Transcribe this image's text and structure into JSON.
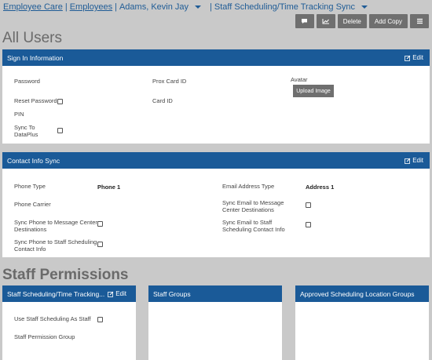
{
  "breadcrumb": {
    "items": [
      "Employee Care",
      "Employees",
      "Adams, Kevin Jay",
      "Staff Scheduling/Time Tracking Sync"
    ]
  },
  "toolbar": {
    "comment_icon": "comment-icon",
    "chart_icon": "chart-icon",
    "delete_label": "Delete",
    "add_copy_label": "Add Copy",
    "menu_icon": "hamburger-icon"
  },
  "page_title": "All Users",
  "sign_in": {
    "title": "Sign In Information",
    "edit": "Edit",
    "password": "Password",
    "reset_password": "Reset Password",
    "pin": "PIN",
    "sync_to_dataplus": "Sync To DataPlus",
    "prox_card_id": "Prox Card ID",
    "card_id": "Card ID",
    "avatar": "Avatar",
    "upload_image": "Upload Image"
  },
  "contact": {
    "title": "Contact Info Sync",
    "edit": "Edit",
    "phone_type": "Phone Type",
    "phone_type_value": "Phone 1",
    "phone_carrier": "Phone Carrier",
    "sync_phone_msg": "Sync Phone to Message Center Destinations",
    "sync_phone_staff": "Sync Phone to Staff Scheduling Contact Info",
    "email_type": "Email Address Type",
    "email_type_value": "Address 1",
    "sync_email_msg": "Sync Email to Message Center Destinations",
    "sync_email_staff": "Sync Email to Staff Scheduling Contact Info"
  },
  "permissions_title": "Staff Permissions",
  "staff_sched": {
    "title": "Staff Scheduling/Time Tracking...",
    "edit": "Edit",
    "use_staff": "Use Staff Scheduling As Staff",
    "perm_group": "Staff Permission Group"
  },
  "staff_groups": {
    "title": "Staff Groups"
  },
  "approved_groups": {
    "title": "Approved Scheduling Location Groups"
  }
}
